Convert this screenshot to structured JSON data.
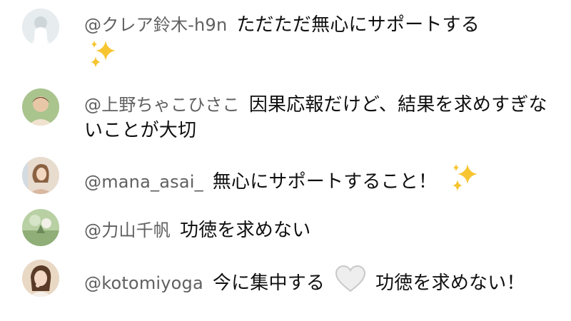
{
  "chat": {
    "messages": [
      {
        "author": "@クレア鈴木-h9n",
        "text": "ただただ無心にサポートする",
        "emoji_after": "sparkles-icon",
        "avatar_bg": "#e7ecef"
      },
      {
        "author": "@上野ちゃこひさこ",
        "text": "因果応報だけど、結果を求めすぎないことが大切",
        "avatar_bg": "#a9c48d"
      },
      {
        "author": "@mana_asai_",
        "text": "無心にサポートすること！",
        "emoji_after": "sparkles-icon",
        "avatar_bg": "#e8dccf"
      },
      {
        "author": "@力山千帆",
        "text": "功徳を求めない",
        "avatar_bg": "#b8d0a3"
      },
      {
        "author": "@kotomiyoga",
        "text_before": "今に集中する",
        "emoji_mid": "white-heart-icon",
        "text_after": "功徳を求めない！",
        "avatar_bg": "#e9d8c4"
      }
    ]
  },
  "colors": {
    "author": "#606060",
    "text": "#0f0f0f",
    "background": "#ffffff",
    "sparkle": "#f7c531"
  }
}
